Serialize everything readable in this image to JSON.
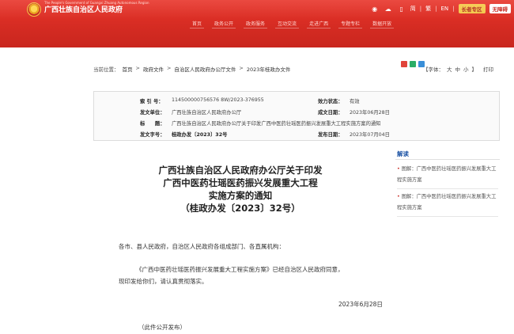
{
  "header": {
    "site_title": "广西壮族自治区人民政府",
    "site_title_en": "The People's Government of Guangxi Zhuang Autonomous Region",
    "lang_zh_simplified": "简",
    "lang_zh_traditional": "繁",
    "lang_en": "EN",
    "elder_mode": "长者专区",
    "accessibility": "无障碍",
    "nav": [
      "首页",
      "政务公开",
      "政务服务",
      "互动交流",
      "走进广西",
      "专题专栏",
      "数据开放"
    ]
  },
  "breadcrumb": {
    "prefix": "当前位置：",
    "items": [
      "首页",
      "政府文件",
      "自治区人民政府办公厅文件",
      "2023年桂政办文件"
    ]
  },
  "font_controls": {
    "label": "【字体：",
    "large": "大",
    "medium": "中",
    "small": "小",
    "close": "】",
    "print": "打印"
  },
  "meta": {
    "index_label": "索 引 号：",
    "index_value": "114500000756576 8W/2023-376955",
    "status_label": "效力状态：",
    "status_value": "有效",
    "issuer_label": "发文单位：",
    "issuer_value": "广西壮族自治区人民政府办公厅",
    "date_label": "成文日期：",
    "date_value": "2023年06月28日",
    "title_label": "标　　题：",
    "title_value": "广西壮族自治区人民政府办公厅关于印发广西中医药壮瑶医药振兴发展重大工程实施方案的通知",
    "doc_no_label": "发文字号：",
    "doc_no_value": "桂政办发〔2023〕32号",
    "pub_label": "发布日期：",
    "pub_value": "2023年07月04日"
  },
  "document": {
    "title_lines": [
      "广西壮族自治区人民政府办公厅关于印发",
      "广西中医药壮瑶医药振兴发展重大工程",
      "实施方案的通知",
      "（桂政办发〔2023〕32号）"
    ],
    "salutation": "各市、县人民政府，自治区人民政府各组成部门、各直属机构：",
    "body_line1": "《广西中医药壮瑶医药振兴发展重大工程实施方案》已经自治区人民政府同意，",
    "body_line2": "现印发给你们，请认真贯彻落实。",
    "date": "2023年6月28日",
    "note": "（此件公开发布）"
  },
  "sidebar": {
    "title": "解读",
    "items": [
      "图解：广西中医药壮瑶医药振兴发展重大工程实施方案",
      "图解：广西中医药壮瑶医药振兴发展重大工程实施方案"
    ]
  },
  "colors": {
    "brand_red": "#d42b22",
    "link_blue": "#1f55a5"
  }
}
